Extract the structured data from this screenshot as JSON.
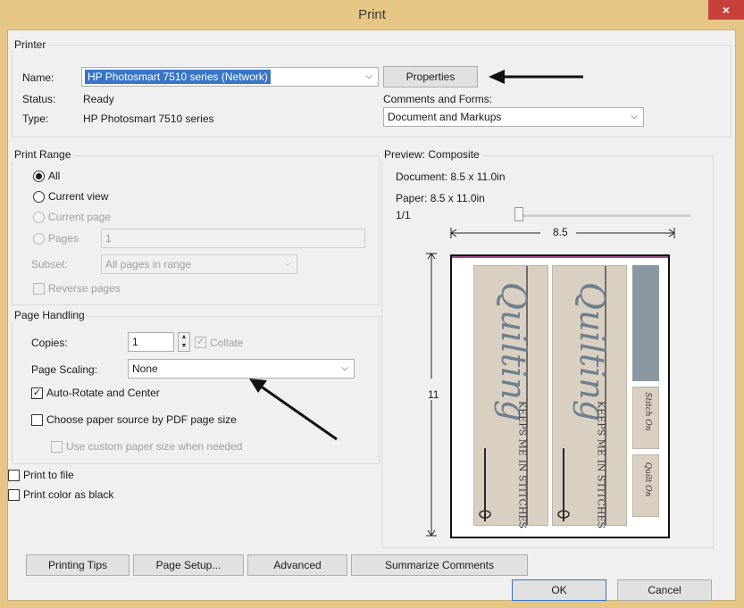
{
  "window": {
    "title": "Print",
    "close_glyph": "×"
  },
  "printer": {
    "group_label": "Printer",
    "name_label": "Name:",
    "name_value": "HP Photosmart 7510 series (Network)",
    "status_label": "Status:",
    "status_value": "Ready",
    "type_label": "Type:",
    "type_value": "HP Photosmart 7510 series",
    "properties_button": "Properties",
    "comments_label": "Comments and Forms:",
    "comments_value": "Document and Markups"
  },
  "print_range": {
    "group_label": "Print Range",
    "all": "All",
    "current_view": "Current view",
    "current_page": "Current page",
    "pages": "Pages",
    "pages_value": "1",
    "subset_label": "Subset:",
    "subset_value": "All pages in range",
    "reverse_pages": "Reverse pages"
  },
  "page_handling": {
    "group_label": "Page Handling",
    "copies_label": "Copies:",
    "copies_value": "1",
    "collate": "Collate",
    "scaling_label": "Page Scaling:",
    "scaling_value": "None",
    "auto_rotate": "Auto-Rotate and Center",
    "choose_paper": "Choose paper source by PDF page size",
    "custom_paper": "Use custom paper size when needed"
  },
  "options": {
    "print_to_file": "Print to file",
    "print_color_black": "Print color as black"
  },
  "preview": {
    "group_label": "Preview: Composite",
    "document": "Document: 8.5 x 11.0in",
    "paper": "Paper: 8.5 x 11.0in",
    "page_count": "1/1",
    "width_label": "8.5",
    "height_label": "11",
    "thumbnail_text": {
      "quilting": "Quilting",
      "tagline": "KEEPS ME IN STITCHES",
      "stitch_on": "Stitch On",
      "quilt_on": "Quilt On"
    }
  },
  "buttons": {
    "printing_tips": "Printing Tips",
    "page_setup": "Page Setup...",
    "advanced": "Advanced",
    "summarize": "Summarize Comments",
    "ok": "OK",
    "cancel": "Cancel"
  },
  "colors": {
    "titlebar": "#e6c684",
    "selection": "#3875c8",
    "close": "#c7403a",
    "arrow": "#111111"
  }
}
